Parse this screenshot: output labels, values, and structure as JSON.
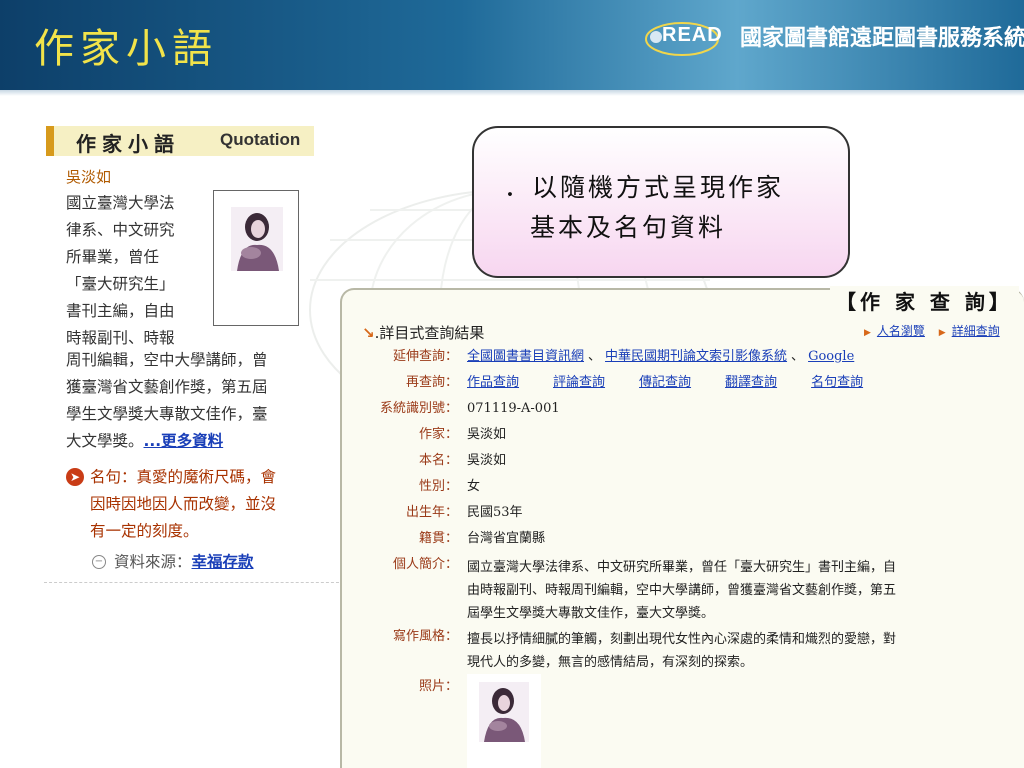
{
  "banner": {
    "title": "作家小語",
    "logo_text": "READ",
    "system_name": "國家圖書館遠距圖書服務系統"
  },
  "widget": {
    "title": "作家小語",
    "title_en": "Quotation",
    "author": "吳淡如",
    "bio_narrow": [
      "國立臺灣大學法",
      "律系、中文研究",
      "所畢業，曾任",
      "「臺大研究生」",
      "書刊主編，自由",
      "時報副刊、時報"
    ],
    "bio_wide": [
      "周刊編輯，空中大學講師，曾",
      "獲臺灣省文藝創作獎，第五屆",
      "學生文學獎大專散文佳作，臺"
    ],
    "bio_last": "大文學獎。",
    "more_link": "...更多資料",
    "quote": [
      "名句：真愛的魔術尺碼，會",
      "因時因地因人而改變，並沒",
      "有一定的刻度。"
    ],
    "source_label": "資料來源：",
    "source_link": "幸福存款"
  },
  "callout": {
    "line1": "．以隨機方式呈現作家",
    "line2": "基本及名句資料"
  },
  "panel": {
    "header": "【作 家 查 詢】",
    "result_title": ".詳目式查詢結果",
    "nav": [
      "人名瀏覽",
      "詳細查詢"
    ],
    "extend_label": "延伸查詢：",
    "extend_links": [
      "全國圖書書目資訊網",
      "中華民國期刊論文索引影像系統",
      "Google"
    ],
    "requery_label": "再查詢：",
    "requery_links": [
      "作品查詢",
      "評論查詢",
      "傳記查詢",
      "翻譯查詢",
      "名句查詢"
    ],
    "fields": [
      {
        "label": "系統識別號：",
        "value": "071119-A-001"
      },
      {
        "label": "作家：",
        "value": "吳淡如"
      },
      {
        "label": "本名：",
        "value": "吳淡如"
      },
      {
        "label": "性別：",
        "value": "女"
      },
      {
        "label": "出生年：",
        "value": "民國53年"
      },
      {
        "label": "籍貫：",
        "value": "台灣省宜蘭縣"
      }
    ],
    "intro_label": "個人簡介：",
    "intro_lines": [
      "國立臺灣大學法律系、中文研究所畢業，曾任「臺大研究生」書刊主編，自",
      "由時報副刊、時報周刊編輯，空中大學講師，曾獲臺灣省文藝創作獎，第五",
      "屆學生文學獎大專散文佳作，臺大文學獎。"
    ],
    "style_label": "寫作風格：",
    "style_lines": [
      "擅長以抒情細膩的筆觸，刻劃出現代女性內心深處的柔情和熾烈的愛戀，對",
      "現代人的多變，無言的感情結局，有深刻的探索。"
    ],
    "photo_label": "照片："
  }
}
